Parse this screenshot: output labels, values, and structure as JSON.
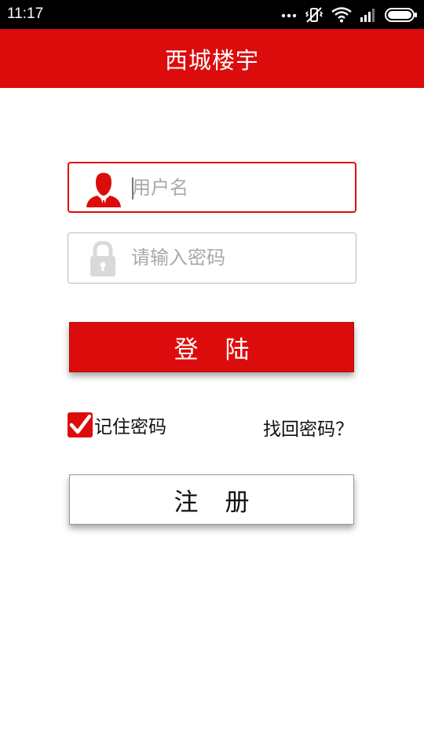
{
  "status_bar": {
    "time": "11:17",
    "icons": [
      "more-dots-icon",
      "vibrate-muted-icon",
      "wifi-icon",
      "signal-icon",
      "battery-icon"
    ]
  },
  "header": {
    "title": "西城楼宇"
  },
  "login_form": {
    "username": {
      "value": "",
      "placeholder": "用户名",
      "icon": "user-icon"
    },
    "password": {
      "value": "",
      "placeholder": "请输入密码",
      "icon": "lock-icon"
    },
    "login_button": "登陆",
    "remember_password": {
      "label": "记住密码",
      "checked": true
    },
    "forgot_password": "找回密码？",
    "register_button": "注册"
  },
  "colors": {
    "accent": "#dc0c0c",
    "status_bar": "#000000",
    "background": "#ffffff",
    "placeholder": "#a9a9a9",
    "icon_gray": "#d9d9d9"
  }
}
